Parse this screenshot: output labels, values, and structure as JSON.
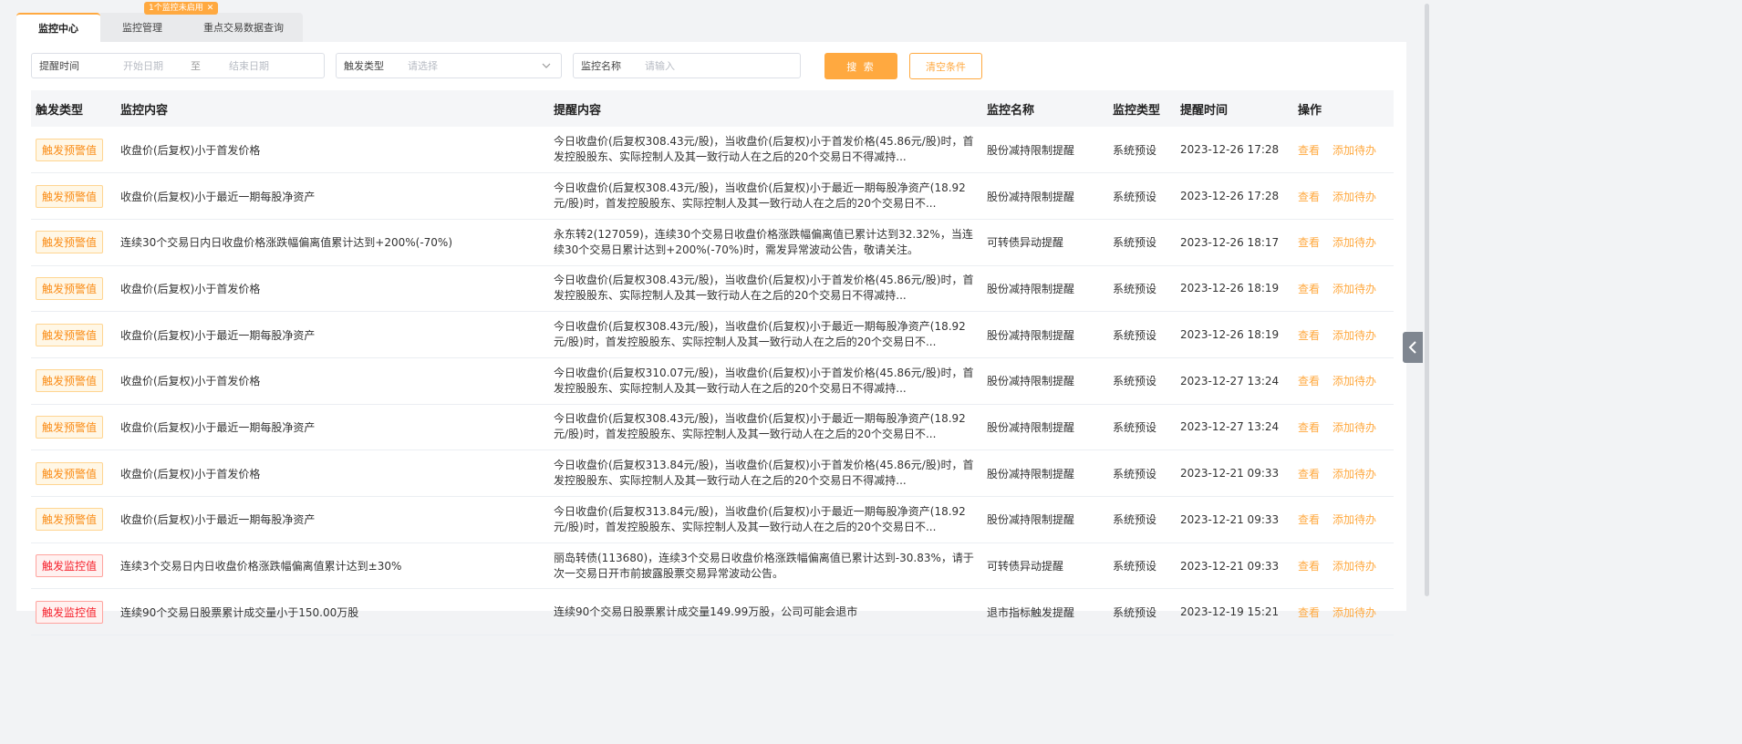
{
  "tabs": [
    {
      "label": "监控中心"
    },
    {
      "label": "监控管理"
    },
    {
      "label": "重点交易数据查询"
    }
  ],
  "badge": {
    "text": "1个监控未启用",
    "close": "✕"
  },
  "filters": {
    "time_label": "提醒时间",
    "start_placeholder": "开始日期",
    "to": "至",
    "end_placeholder": "结束日期",
    "trigger_label": "触发类型",
    "trigger_placeholder": "请选择",
    "name_label": "监控名称",
    "name_placeholder": "请输入",
    "search": "搜 索",
    "clear": "清空条件"
  },
  "table": {
    "headers": [
      "触发类型",
      "监控内容",
      "提醒内容",
      "监控名称",
      "监控类型",
      "提醒时间",
      "操作"
    ],
    "actions": {
      "view": "查看",
      "todo": "添加待办"
    },
    "rows": [
      {
        "tag": "触发预警值",
        "tag_kind": "warn",
        "content": "收盘价(后复权)小于首发价格",
        "remind": "今日收盘价(后复权308.43元/股)，当收盘价(后复权)小于首发价格(45.86元/股)时，首发控股股东、实际控制人及其一致行动人在之后的20个交易日不得减持...",
        "name": "股份减持限制提醒",
        "type": "系统预设",
        "time": "2023-12-26 17:28"
      },
      {
        "tag": "触发预警值",
        "tag_kind": "warn",
        "content": "收盘价(后复权)小于最近一期每股净资产",
        "remind": "今日收盘价(后复权308.43元/股)，当收盘价(后复权)小于最近一期每股净资产(18.92元/股)时，首发控股股东、实际控制人及其一致行动人在之后的20个交易日不...",
        "name": "股份减持限制提醒",
        "type": "系统预设",
        "time": "2023-12-26 17:28"
      },
      {
        "tag": "触发预警值",
        "tag_kind": "warn",
        "content": "连续30个交易日内日收盘价格涨跌幅偏离值累计达到+200%(-70%)",
        "remind": "永东转2(127059)，连续30个交易日收盘价格涨跌幅偏离值已累计达到32.32%，当连续30个交易日累计达到+200%(-70%)时，需发异常波动公告，敬请关注。",
        "name": "可转债异动提醒",
        "type": "系统预设",
        "time": "2023-12-26 18:17"
      },
      {
        "tag": "触发预警值",
        "tag_kind": "warn",
        "content": "收盘价(后复权)小于首发价格",
        "remind": "今日收盘价(后复权308.43元/股)，当收盘价(后复权)小于首发价格(45.86元/股)时，首发控股股东、实际控制人及其一致行动人在之后的20个交易日不得减持...",
        "name": "股份减持限制提醒",
        "type": "系统预设",
        "time": "2023-12-26 18:19"
      },
      {
        "tag": "触发预警值",
        "tag_kind": "warn",
        "content": "收盘价(后复权)小于最近一期每股净资产",
        "remind": "今日收盘价(后复权308.43元/股)，当收盘价(后复权)小于最近一期每股净资产(18.92元/股)时，首发控股股东、实际控制人及其一致行动人在之后的20个交易日不...",
        "name": "股份减持限制提醒",
        "type": "系统预设",
        "time": "2023-12-26 18:19"
      },
      {
        "tag": "触发预警值",
        "tag_kind": "warn",
        "content": "收盘价(后复权)小于首发价格",
        "remind": "今日收盘价(后复权310.07元/股)，当收盘价(后复权)小于首发价格(45.86元/股)时，首发控股股东、实际控制人及其一致行动人在之后的20个交易日不得减持...",
        "name": "股份减持限制提醒",
        "type": "系统预设",
        "time": "2023-12-27 13:24"
      },
      {
        "tag": "触发预警值",
        "tag_kind": "warn",
        "content": "收盘价(后复权)小于最近一期每股净资产",
        "remind": "今日收盘价(后复权308.43元/股)，当收盘价(后复权)小于最近一期每股净资产(18.92元/股)时，首发控股股东、实际控制人及其一致行动人在之后的20个交易日不...",
        "name": "股份减持限制提醒",
        "type": "系统预设",
        "time": "2023-12-27 13:24"
      },
      {
        "tag": "触发预警值",
        "tag_kind": "warn",
        "content": "收盘价(后复权)小于首发价格",
        "remind": "今日收盘价(后复权313.84元/股)，当收盘价(后复权)小于首发价格(45.86元/股)时，首发控股股东、实际控制人及其一致行动人在之后的20个交易日不得减持...",
        "name": "股份减持限制提醒",
        "type": "系统预设",
        "time": "2023-12-21 09:33"
      },
      {
        "tag": "触发预警值",
        "tag_kind": "warn",
        "content": "收盘价(后复权)小于最近一期每股净资产",
        "remind": "今日收盘价(后复权313.84元/股)，当收盘价(后复权)小于最近一期每股净资产(18.92元/股)时，首发控股股东、实际控制人及其一致行动人在之后的20个交易日不...",
        "name": "股份减持限制提醒",
        "type": "系统预设",
        "time": "2023-12-21 09:33"
      },
      {
        "tag": "触发监控值",
        "tag_kind": "mon",
        "content": "连续3个交易日内日收盘价格涨跌幅偏离值累计达到±30%",
        "remind": "丽岛转债(113680)，连续3个交易日收盘价格涨跌幅偏离值已累计达到-30.83%，请于次一交易日开市前披露股票交易异常波动公告。",
        "name": "可转债异动提醒",
        "type": "系统预设",
        "time": "2023-12-21 09:33"
      },
      {
        "tag": "触发监控值",
        "tag_kind": "mon",
        "content": "连续90个交易日股票累计成交量小于150.00万股",
        "remind": "连续90个交易日股票累计成交量149.99万股，公司可能会退市",
        "name": "退市指标触发提醒",
        "type": "系统预设",
        "time": "2023-12-19 15:21"
      }
    ]
  },
  "icons": {
    "dropdown": "chevron-down-icon",
    "side": "chevron-left-icon"
  },
  "colors": {
    "accent": "#ffa940",
    "warn_tag": "#fa8c16",
    "monitor_tag": "#f5222d"
  }
}
